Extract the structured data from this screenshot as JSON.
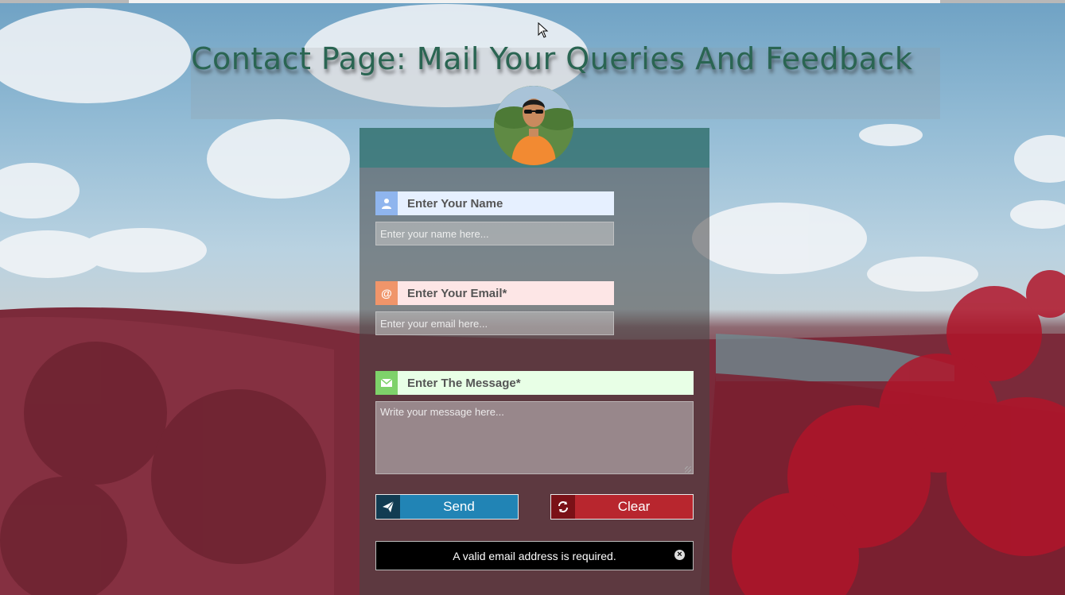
{
  "header": {
    "title": "Contact Page: Mail Your Queries And Feedback"
  },
  "form": {
    "name": {
      "label": "Enter Your Name",
      "placeholder": "Enter your name here...",
      "icon": "user-icon",
      "accent": "#8fb5ee"
    },
    "email": {
      "label": "Enter Your Email*",
      "placeholder": "Enter your email here...",
      "icon": "at-sign-icon",
      "accent": "#f0956a"
    },
    "message": {
      "label": "Enter The Message*",
      "placeholder": "Write your message here...",
      "icon": "envelope-icon",
      "accent": "#7ed26a"
    },
    "buttons": {
      "send_label": "Send",
      "clear_label": "Clear"
    }
  },
  "alert": {
    "text": "A valid email address is required."
  },
  "colors": {
    "title": "#2a6552",
    "send": "#2184b5",
    "clear": "#b8262e"
  }
}
